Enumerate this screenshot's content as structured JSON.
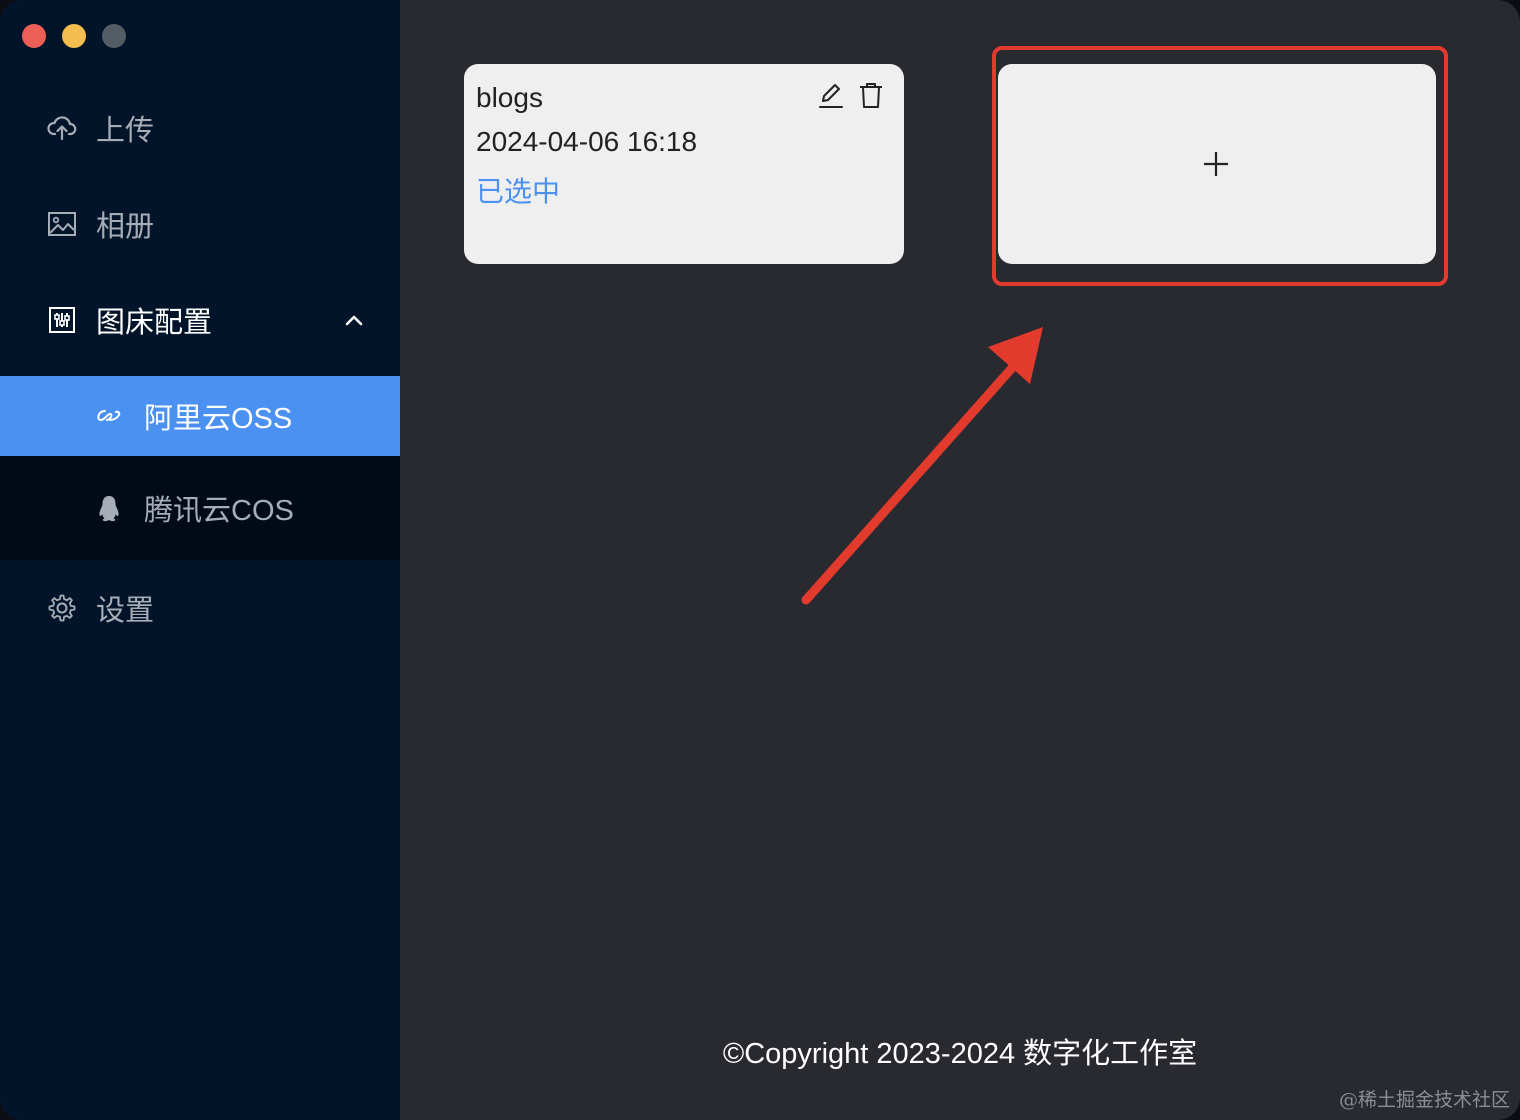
{
  "window": {
    "traffic_lights": [
      "close",
      "minimize",
      "zoom"
    ]
  },
  "sidebar": {
    "items": [
      {
        "label": "上传",
        "icon": "cloud-upload-icon"
      },
      {
        "label": "相册",
        "icon": "image-icon"
      },
      {
        "label": "图床配置",
        "icon": "sliders-icon",
        "expanded": true
      },
      {
        "label": "设置",
        "icon": "gear-icon"
      }
    ],
    "sub_items": [
      {
        "label": "阿里云OSS",
        "icon": "aliyun-icon",
        "active": true
      },
      {
        "label": "腾讯云COS",
        "icon": "penguin-icon",
        "active": false
      }
    ]
  },
  "config_card": {
    "name": "blogs",
    "date": "2024-04-06 16:18",
    "status": "已选中"
  },
  "add_card": {
    "icon": "plus-icon"
  },
  "footer": {
    "copyright": "©Copyright 2023-2024 数字化工作室"
  },
  "watermark": "@稀土掘金技术社区",
  "colors": {
    "sidebar_bg": "#021429",
    "active_bg": "#4a91f2",
    "main_bg": "#282a30",
    "card_bg": "#efefef",
    "highlight": "#e23b2e"
  }
}
